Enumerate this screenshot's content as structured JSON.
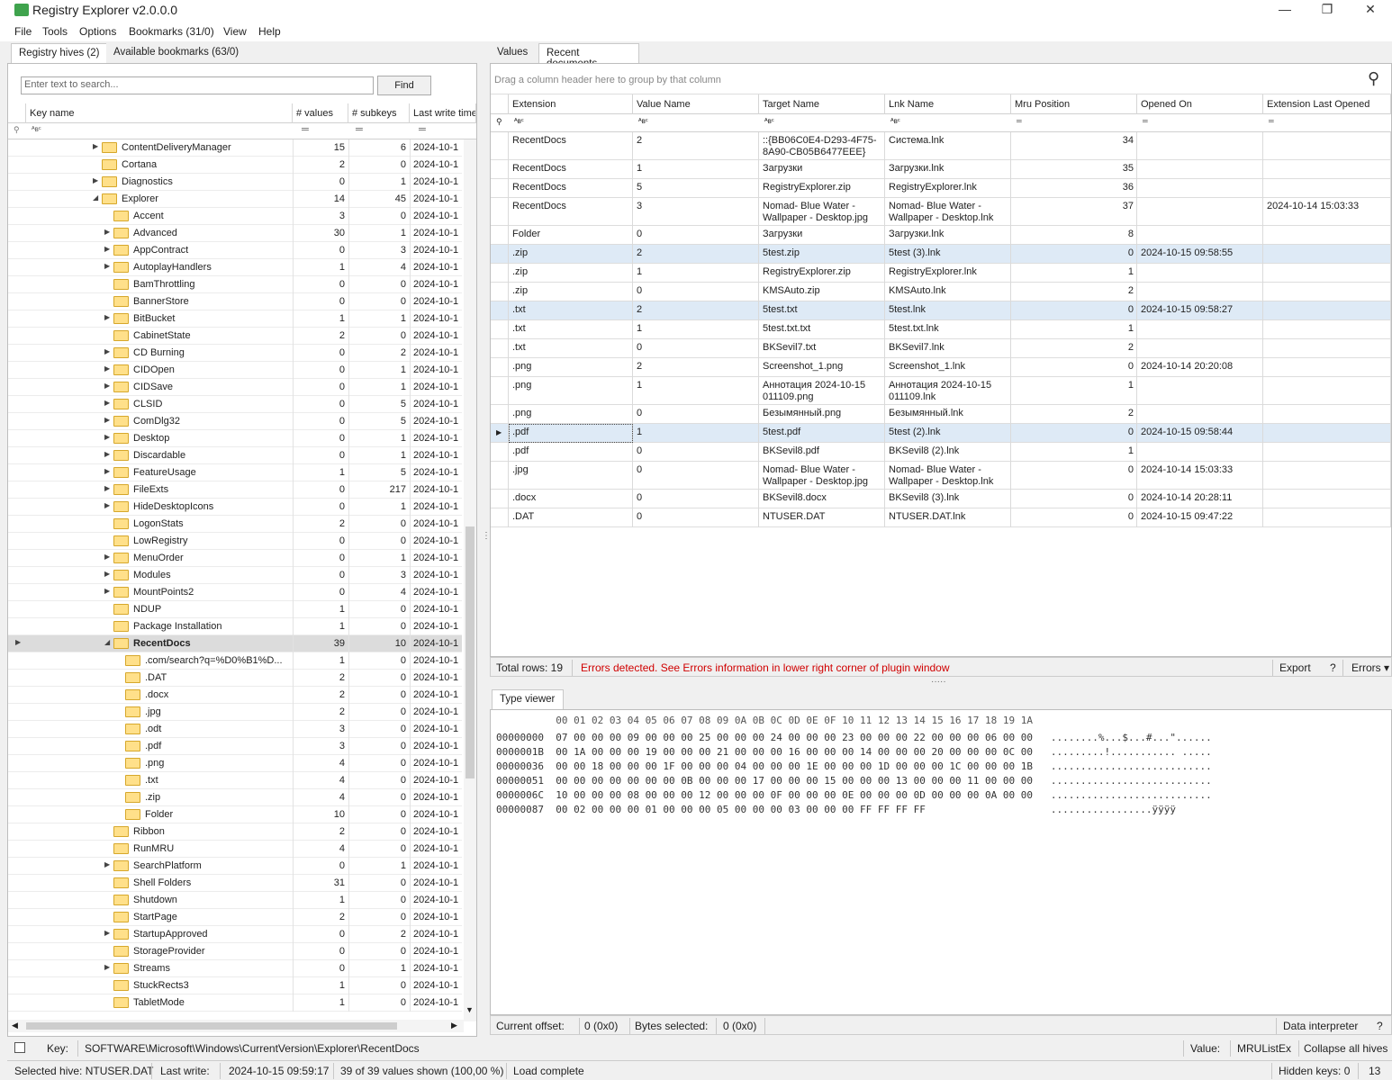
{
  "window": {
    "title": "Registry Explorer v2.0.0.0",
    "minimize": "—",
    "maximize": "❐",
    "close": "✕"
  },
  "menu": [
    "File",
    "Tools",
    "Options",
    "Bookmarks (31/0)",
    "View",
    "Help"
  ],
  "left_tabs": [
    "Registry hives (2)",
    "Available bookmarks (63/0)"
  ],
  "search": {
    "placeholder": "Enter text to search...",
    "find": "Find"
  },
  "tree_columns": [
    "Key name",
    "# values",
    "# subkeys",
    "Last write time"
  ],
  "tree_rows": [
    {
      "name": "ContentDeliveryManager",
      "values": "15",
      "subkeys": "6",
      "date": "2024-10-1",
      "level": 0,
      "exp": "closed"
    },
    {
      "name": "Cortana",
      "values": "2",
      "subkeys": "0",
      "date": "2024-10-1",
      "level": 0,
      "exp": ""
    },
    {
      "name": "Diagnostics",
      "values": "0",
      "subkeys": "1",
      "date": "2024-10-1",
      "level": 0,
      "exp": "closed"
    },
    {
      "name": "Explorer",
      "values": "14",
      "subkeys": "45",
      "date": "2024-10-1",
      "level": 0,
      "exp": "open"
    },
    {
      "name": "Accent",
      "values": "3",
      "subkeys": "0",
      "date": "2024-10-1",
      "level": 1,
      "exp": ""
    },
    {
      "name": "Advanced",
      "values": "30",
      "subkeys": "1",
      "date": "2024-10-1",
      "level": 1,
      "exp": "closed"
    },
    {
      "name": "AppContract",
      "values": "0",
      "subkeys": "3",
      "date": "2024-10-1",
      "level": 1,
      "exp": "closed"
    },
    {
      "name": "AutoplayHandlers",
      "values": "1",
      "subkeys": "4",
      "date": "2024-10-1",
      "level": 1,
      "exp": "closed"
    },
    {
      "name": "BamThrottling",
      "values": "0",
      "subkeys": "0",
      "date": "2024-10-1",
      "level": 1,
      "exp": ""
    },
    {
      "name": "BannerStore",
      "values": "0",
      "subkeys": "0",
      "date": "2024-10-1",
      "level": 1,
      "exp": ""
    },
    {
      "name": "BitBucket",
      "values": "1",
      "subkeys": "1",
      "date": "2024-10-1",
      "level": 1,
      "exp": "closed"
    },
    {
      "name": "CabinetState",
      "values": "2",
      "subkeys": "0",
      "date": "2024-10-1",
      "level": 1,
      "exp": ""
    },
    {
      "name": "CD Burning",
      "values": "0",
      "subkeys": "2",
      "date": "2024-10-1",
      "level": 1,
      "exp": "closed"
    },
    {
      "name": "CIDOpen",
      "values": "0",
      "subkeys": "1",
      "date": "2024-10-1",
      "level": 1,
      "exp": "closed"
    },
    {
      "name": "CIDSave",
      "values": "0",
      "subkeys": "1",
      "date": "2024-10-1",
      "level": 1,
      "exp": "closed"
    },
    {
      "name": "CLSID",
      "values": "0",
      "subkeys": "5",
      "date": "2024-10-1",
      "level": 1,
      "exp": "closed"
    },
    {
      "name": "ComDlg32",
      "values": "0",
      "subkeys": "5",
      "date": "2024-10-1",
      "level": 1,
      "exp": "closed"
    },
    {
      "name": "Desktop",
      "values": "0",
      "subkeys": "1",
      "date": "2024-10-1",
      "level": 1,
      "exp": "closed"
    },
    {
      "name": "Discardable",
      "values": "0",
      "subkeys": "1",
      "date": "2024-10-1",
      "level": 1,
      "exp": "closed"
    },
    {
      "name": "FeatureUsage",
      "values": "1",
      "subkeys": "5",
      "date": "2024-10-1",
      "level": 1,
      "exp": "closed"
    },
    {
      "name": "FileExts",
      "values": "0",
      "subkeys": "217",
      "date": "2024-10-1",
      "level": 1,
      "exp": "closed"
    },
    {
      "name": "HideDesktopIcons",
      "values": "0",
      "subkeys": "1",
      "date": "2024-10-1",
      "level": 1,
      "exp": "closed"
    },
    {
      "name": "LogonStats",
      "values": "2",
      "subkeys": "0",
      "date": "2024-10-1",
      "level": 1,
      "exp": ""
    },
    {
      "name": "LowRegistry",
      "values": "0",
      "subkeys": "0",
      "date": "2024-10-1",
      "level": 1,
      "exp": ""
    },
    {
      "name": "MenuOrder",
      "values": "0",
      "subkeys": "1",
      "date": "2024-10-1",
      "level": 1,
      "exp": "closed"
    },
    {
      "name": "Modules",
      "values": "0",
      "subkeys": "3",
      "date": "2024-10-1",
      "level": 1,
      "exp": "closed"
    },
    {
      "name": "MountPoints2",
      "values": "0",
      "subkeys": "4",
      "date": "2024-10-1",
      "level": 1,
      "exp": "closed"
    },
    {
      "name": "NDUP",
      "values": "1",
      "subkeys": "0",
      "date": "2024-10-1",
      "level": 1,
      "exp": ""
    },
    {
      "name": "Package Installation",
      "values": "1",
      "subkeys": "0",
      "date": "2024-10-1",
      "level": 1,
      "exp": ""
    },
    {
      "name": "RecentDocs",
      "values": "39",
      "subkeys": "10",
      "date": "2024-10-1",
      "level": 1,
      "exp": "open",
      "selected": true
    },
    {
      "name": ".com/search?q=%D0%B1%D...",
      "values": "1",
      "subkeys": "0",
      "date": "2024-10-1",
      "level": 2,
      "exp": ""
    },
    {
      "name": ".DAT",
      "values": "2",
      "subkeys": "0",
      "date": "2024-10-1",
      "level": 2,
      "exp": ""
    },
    {
      "name": ".docx",
      "values": "2",
      "subkeys": "0",
      "date": "2024-10-1",
      "level": 2,
      "exp": ""
    },
    {
      "name": ".jpg",
      "values": "2",
      "subkeys": "0",
      "date": "2024-10-1",
      "level": 2,
      "exp": ""
    },
    {
      "name": ".odt",
      "values": "3",
      "subkeys": "0",
      "date": "2024-10-1",
      "level": 2,
      "exp": ""
    },
    {
      "name": ".pdf",
      "values": "3",
      "subkeys": "0",
      "date": "2024-10-1",
      "level": 2,
      "exp": ""
    },
    {
      "name": ".png",
      "values": "4",
      "subkeys": "0",
      "date": "2024-10-1",
      "level": 2,
      "exp": ""
    },
    {
      "name": ".txt",
      "values": "4",
      "subkeys": "0",
      "date": "2024-10-1",
      "level": 2,
      "exp": ""
    },
    {
      "name": ".zip",
      "values": "4",
      "subkeys": "0",
      "date": "2024-10-1",
      "level": 2,
      "exp": ""
    },
    {
      "name": "Folder",
      "values": "10",
      "subkeys": "0",
      "date": "2024-10-1",
      "level": 2,
      "exp": ""
    },
    {
      "name": "Ribbon",
      "values": "2",
      "subkeys": "0",
      "date": "2024-10-1",
      "level": 1,
      "exp": ""
    },
    {
      "name": "RunMRU",
      "values": "4",
      "subkeys": "0",
      "date": "2024-10-1",
      "level": 1,
      "exp": ""
    },
    {
      "name": "SearchPlatform",
      "values": "0",
      "subkeys": "1",
      "date": "2024-10-1",
      "level": 1,
      "exp": "closed"
    },
    {
      "name": "Shell Folders",
      "values": "31",
      "subkeys": "0",
      "date": "2024-10-1",
      "level": 1,
      "exp": ""
    },
    {
      "name": "Shutdown",
      "values": "1",
      "subkeys": "0",
      "date": "2024-10-1",
      "level": 1,
      "exp": ""
    },
    {
      "name": "StartPage",
      "values": "2",
      "subkeys": "0",
      "date": "2024-10-1",
      "level": 1,
      "exp": ""
    },
    {
      "name": "StartupApproved",
      "values": "0",
      "subkeys": "2",
      "date": "2024-10-1",
      "level": 1,
      "exp": "closed"
    },
    {
      "name": "StorageProvider",
      "values": "0",
      "subkeys": "0",
      "date": "2024-10-1",
      "level": 1,
      "exp": ""
    },
    {
      "name": "Streams",
      "values": "0",
      "subkeys": "1",
      "date": "2024-10-1",
      "level": 1,
      "exp": "closed"
    },
    {
      "name": "StuckRects3",
      "values": "1",
      "subkeys": "0",
      "date": "2024-10-1",
      "level": 1,
      "exp": ""
    },
    {
      "name": "TabletMode",
      "values": "1",
      "subkeys": "0",
      "date": "2024-10-1",
      "level": 1,
      "exp": ""
    }
  ],
  "right_tabs": [
    "Values",
    "Recent documents"
  ],
  "grid": {
    "group_hint": "Drag a column header here to group by that column",
    "columns": [
      "Extension",
      "Value Name",
      "Target Name",
      "Lnk Name",
      "Mru Position",
      "Opened On",
      "Extension Last Opened"
    ],
    "rows": [
      {
        "ext": "RecentDocs",
        "val": "2",
        "target": "::{BB06C0E4-D293-4F75-8A90-CB05B6477EEE}",
        "lnk": "Система.lnk",
        "mru": "34",
        "opened": "",
        "last": "",
        "h": 31
      },
      {
        "ext": "RecentDocs",
        "val": "1",
        "target": "Загрузки",
        "lnk": "Загрузки.lnk",
        "mru": "35",
        "opened": "",
        "last": "",
        "h": 21
      },
      {
        "ext": "RecentDocs",
        "val": "5",
        "target": "RegistryExplorer.zip",
        "lnk": "RegistryExplorer.lnk",
        "mru": "36",
        "opened": "",
        "last": "",
        "h": 21
      },
      {
        "ext": "RecentDocs",
        "val": "3",
        "target": "Nomad- Blue Water - Wallpaper - Desktop.jpg",
        "lnk": "Nomad- Blue Water - Wallpaper - Desktop.lnk",
        "mru": "37",
        "opened": "",
        "last": "2024-10-14 15:03:33",
        "h": 31
      },
      {
        "ext": "Folder",
        "val": "0",
        "target": "Загрузки",
        "lnk": "Загрузки.lnk",
        "mru": "8",
        "opened": "",
        "last": "",
        "h": 21
      },
      {
        "ext": ".zip",
        "val": "2",
        "target": "5test.zip",
        "lnk": "5test (3).lnk",
        "mru": "0",
        "opened": "2024-10-15 09:58:55",
        "last": "",
        "h": 21,
        "hl": true
      },
      {
        "ext": ".zip",
        "val": "1",
        "target": "RegistryExplorer.zip",
        "lnk": "RegistryExplorer.lnk",
        "mru": "1",
        "opened": "",
        "last": "",
        "h": 21
      },
      {
        "ext": ".zip",
        "val": "0",
        "target": "KMSAuto.zip",
        "lnk": "KMSAuto.lnk",
        "mru": "2",
        "opened": "",
        "last": "",
        "h": 21
      },
      {
        "ext": ".txt",
        "val": "2",
        "target": "5test.txt",
        "lnk": "5test.lnk",
        "mru": "0",
        "opened": "2024-10-15 09:58:27",
        "last": "",
        "h": 21,
        "hl": true
      },
      {
        "ext": ".txt",
        "val": "1",
        "target": "5test.txt.txt",
        "lnk": "5test.txt.lnk",
        "mru": "1",
        "opened": "",
        "last": "",
        "h": 21
      },
      {
        "ext": ".txt",
        "val": "0",
        "target": "BKSevil7.txt",
        "lnk": "BKSevil7.lnk",
        "mru": "2",
        "opened": "",
        "last": "",
        "h": 21
      },
      {
        "ext": ".png",
        "val": "2",
        "target": "Screenshot_1.png",
        "lnk": "Screenshot_1.lnk",
        "mru": "0",
        "opened": "2024-10-14 20:20:08",
        "last": "",
        "h": 21
      },
      {
        "ext": ".png",
        "val": "1",
        "target": "Аннотация 2024-10-15 011109.png",
        "lnk": "Аннотация 2024-10-15 011109.lnk",
        "mru": "1",
        "opened": "",
        "last": "",
        "h": 31
      },
      {
        "ext": ".png",
        "val": "0",
        "target": "Безымянный.png",
        "lnk": "Безымянный.lnk",
        "mru": "2",
        "opened": "",
        "last": "",
        "h": 21
      },
      {
        "ext": ".pdf",
        "val": "1",
        "target": "5test.pdf",
        "lnk": "5test (2).lnk",
        "mru": "0",
        "opened": "2024-10-15 09:58:44",
        "last": "",
        "h": 21,
        "hl": true,
        "cur": true
      },
      {
        "ext": ".pdf",
        "val": "0",
        "target": "BKSevil8.pdf",
        "lnk": "BKSevil8 (2).lnk",
        "mru": "1",
        "opened": "",
        "last": "",
        "h": 21
      },
      {
        "ext": ".jpg",
        "val": "0",
        "target": "Nomad- Blue Water - Wallpaper - Desktop.jpg",
        "lnk": "Nomad- Blue Water - Wallpaper - Desktop.lnk",
        "mru": "0",
        "opened": "2024-10-14 15:03:33",
        "last": "",
        "h": 31
      },
      {
        "ext": ".docx",
        "val": "0",
        "target": "BKSevil8.docx",
        "lnk": "BKSevil8 (3).lnk",
        "mru": "0",
        "opened": "2024-10-14 20:28:11",
        "last": "",
        "h": 21
      },
      {
        "ext": ".DAT",
        "val": "0",
        "target": "NTUSER.DAT",
        "lnk": "NTUSER.DAT.lnk",
        "mru": "0",
        "opened": "2024-10-15 09:47:22",
        "last": "",
        "h": 21
      }
    ]
  },
  "grid_status": {
    "total": "Total rows: 19",
    "error": "Errors detected. See Errors information in lower right corner of plugin window",
    "export": "Export",
    "help": "?",
    "errors": "Errors ▾"
  },
  "type_viewer": {
    "tab": "Type viewer",
    "header": "          00 01 02 03 04 05 06 07 08 09 0A 0B 0C 0D 0E 0F 10 11 12 13 14 15 16 17 18 19 1A",
    "lines": [
      "00000000  07 00 00 00 09 00 00 00 25 00 00 00 24 00 00 00 23 00 00 00 22 00 00 00 06 00 00   ........%...$...#...\"......",
      "0000001B  00 1A 00 00 00 19 00 00 00 21 00 00 00 16 00 00 00 14 00 00 00 20 00 00 00 0C 00   .........!........... .....",
      "00000036  00 00 18 00 00 00 1F 00 00 00 04 00 00 00 1E 00 00 00 1D 00 00 00 1C 00 00 00 1B   ...........................",
      "00000051  00 00 00 00 00 00 00 0B 00 00 00 17 00 00 00 15 00 00 00 13 00 00 00 11 00 00 00   ...........................",
      "0000006C  10 00 00 00 08 00 00 00 12 00 00 00 0F 00 00 00 0E 00 00 00 0D 00 00 00 0A 00 00   ...........................",
      "00000087  00 02 00 00 00 01 00 00 00 05 00 00 00 03 00 00 00 FF FF FF FF                     .................ÿÿÿÿ"
    ]
  },
  "hex_status": {
    "offset_label": "Current offset:",
    "offset": "0 (0x0)",
    "bytes_label": "Bytes selected:",
    "bytes": "0 (0x0)",
    "interp": "Data interpreter",
    "help": "?"
  },
  "key_bar": {
    "key_label": "Key:",
    "key": "SOFTWARE\\Microsoft\\Windows\\CurrentVersion\\Explorer\\RecentDocs",
    "value_label": "Value:",
    "value": "MRUListEx",
    "collapse": "Collapse all hives"
  },
  "status": {
    "hive": "Selected hive: NTUSER.DAT",
    "lw_label": "Last write:",
    "lw": "2024-10-15 09:59:17",
    "shown": "39 of 39 values shown (100,00 %)",
    "load": "Load complete",
    "hidden": "Hidden keys: 0",
    "count": "13"
  }
}
